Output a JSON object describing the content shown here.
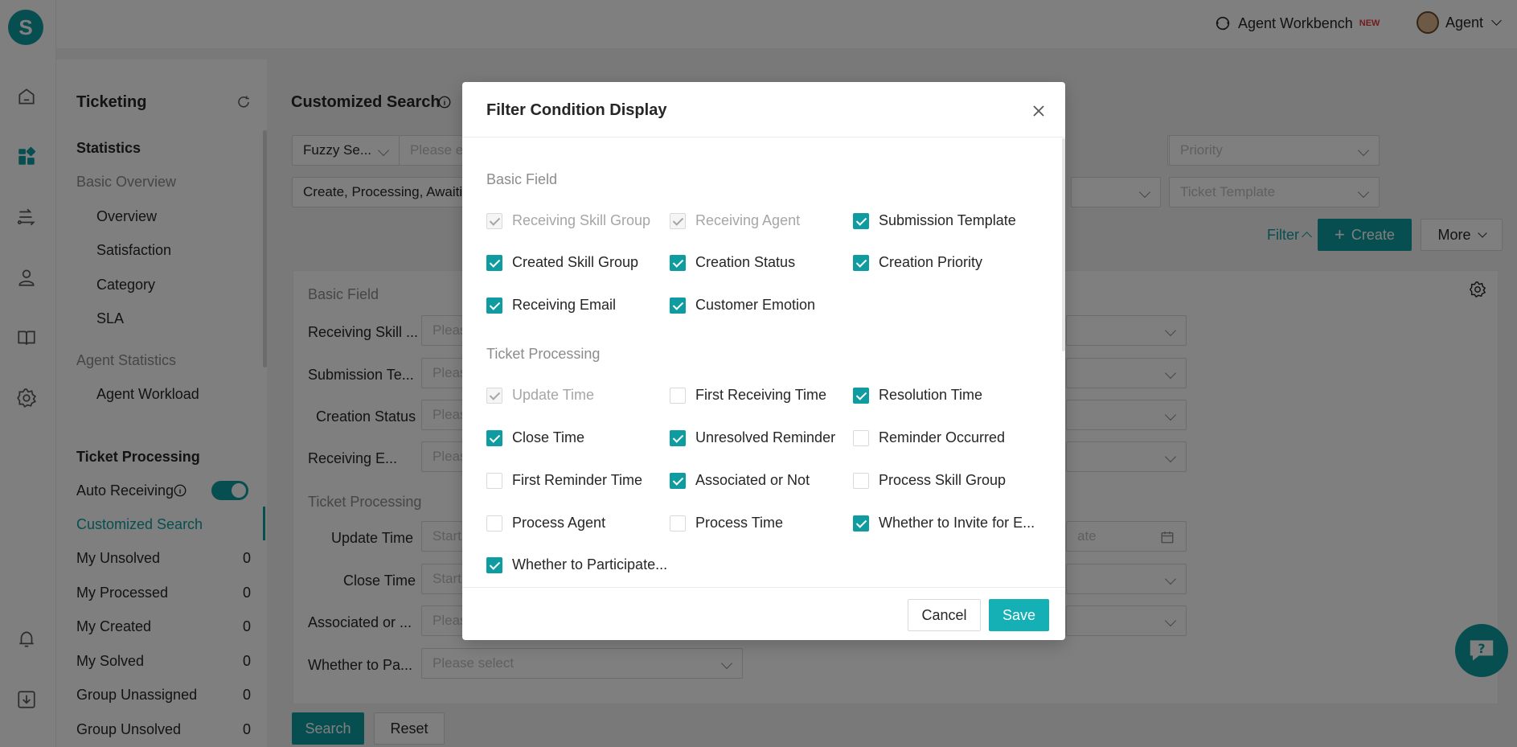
{
  "brand": {
    "logo_letter": "S",
    "accent": "#0e9ca0"
  },
  "topbar": {
    "workbench_label": "Agent Workbench",
    "workbench_badge": "NEW",
    "user_label": "Agent"
  },
  "rail": {
    "icons": [
      "home-icon",
      "dashboard-icon",
      "routing-icon",
      "customer-icon",
      "knowledge-book-icon",
      "settings-icon",
      "bell-icon",
      "download-icon"
    ]
  },
  "side": {
    "title": "Ticketing",
    "statistics": "Statistics",
    "basic_overview": "Basic Overview",
    "overview": "Overview",
    "satisfaction": "Satisfaction",
    "category": "Category",
    "sla": "SLA",
    "agent_statistics": "Agent Statistics",
    "agent_workload": "Agent Workload",
    "ticket_processing": "Ticket Processing",
    "auto_receiving": "Auto Receiving",
    "customized_search": "Customized Search",
    "lists": [
      {
        "label": "My Unsolved",
        "count": "0"
      },
      {
        "label": "My Processed",
        "count": "0"
      },
      {
        "label": "My Created",
        "count": "0"
      },
      {
        "label": "My Solved",
        "count": "0"
      },
      {
        "label": "Group Unassigned",
        "count": "0"
      },
      {
        "label": "Group Unsolved",
        "count": "0"
      }
    ]
  },
  "main": {
    "title": "Customized Search",
    "fuzzy_select": "Fuzzy Se...",
    "fuzzy_placeholder": "Please e",
    "priority_placeholder": "Priority",
    "status_value": "Create, Processing, Awaiti",
    "template_placeholder": "Ticket Template",
    "filter_label": "Filter",
    "create_label": "Create",
    "more_label": "More",
    "form": {
      "basic_field": "Basic Field",
      "ticket_processing": "Ticket Processing",
      "rows": [
        {
          "label": "Receiving Skill ...",
          "placeholder": "Pleas"
        },
        {
          "label": "Submission Te...",
          "placeholder": "Pleas"
        },
        {
          "label": "Creation Status",
          "placeholder": "Pleas"
        },
        {
          "label": "Receiving E...",
          "placeholder": "Pleas"
        },
        {
          "label": "Update Time",
          "placeholder": "Start"
        },
        {
          "label": "Close Time",
          "placeholder": "Start"
        },
        {
          "label": "Associated or ...",
          "placeholder": "Pleas"
        },
        {
          "label": "Whether to Pa...",
          "placeholder": "Please select"
        }
      ],
      "date_end_placeholder": "ate"
    },
    "search_label": "Search",
    "reset_label": "Reset"
  },
  "modal": {
    "title": "Filter Condition Display",
    "basic_field": "Basic Field",
    "ticket_processing": "Ticket Processing",
    "basic_items": [
      {
        "label": "Receiving Skill Group",
        "checked": true,
        "disabled": true
      },
      {
        "label": "Receiving Agent",
        "checked": true,
        "disabled": true
      },
      {
        "label": "Submission Template",
        "checked": true,
        "disabled": false
      },
      {
        "label": "Created Skill Group",
        "checked": true,
        "disabled": false
      },
      {
        "label": "Creation Status",
        "checked": true,
        "disabled": false
      },
      {
        "label": "Creation Priority",
        "checked": true,
        "disabled": false
      },
      {
        "label": "Receiving Email",
        "checked": true,
        "disabled": false
      },
      {
        "label": "Customer Emotion",
        "checked": true,
        "disabled": false
      }
    ],
    "processing_items": [
      {
        "label": "Update Time",
        "checked": true,
        "disabled": true
      },
      {
        "label": "First Receiving Time",
        "checked": false,
        "disabled": false
      },
      {
        "label": "Resolution Time",
        "checked": true,
        "disabled": false
      },
      {
        "label": "Close Time",
        "checked": true,
        "disabled": false
      },
      {
        "label": "Unresolved Reminder",
        "checked": true,
        "disabled": false
      },
      {
        "label": "Reminder Occurred",
        "checked": false,
        "disabled": false
      },
      {
        "label": "First Reminder Time",
        "checked": false,
        "disabled": false
      },
      {
        "label": "Associated or Not",
        "checked": true,
        "disabled": false
      },
      {
        "label": "Process Skill Group",
        "checked": false,
        "disabled": false
      },
      {
        "label": "Process Agent",
        "checked": false,
        "disabled": false
      },
      {
        "label": "Process Time",
        "checked": false,
        "disabled": false
      },
      {
        "label": "Whether to Invite for E...",
        "checked": true,
        "disabled": false
      },
      {
        "label": "Whether to Participate...",
        "checked": true,
        "disabled": false
      }
    ],
    "cancel_label": "Cancel",
    "save_label": "Save"
  }
}
